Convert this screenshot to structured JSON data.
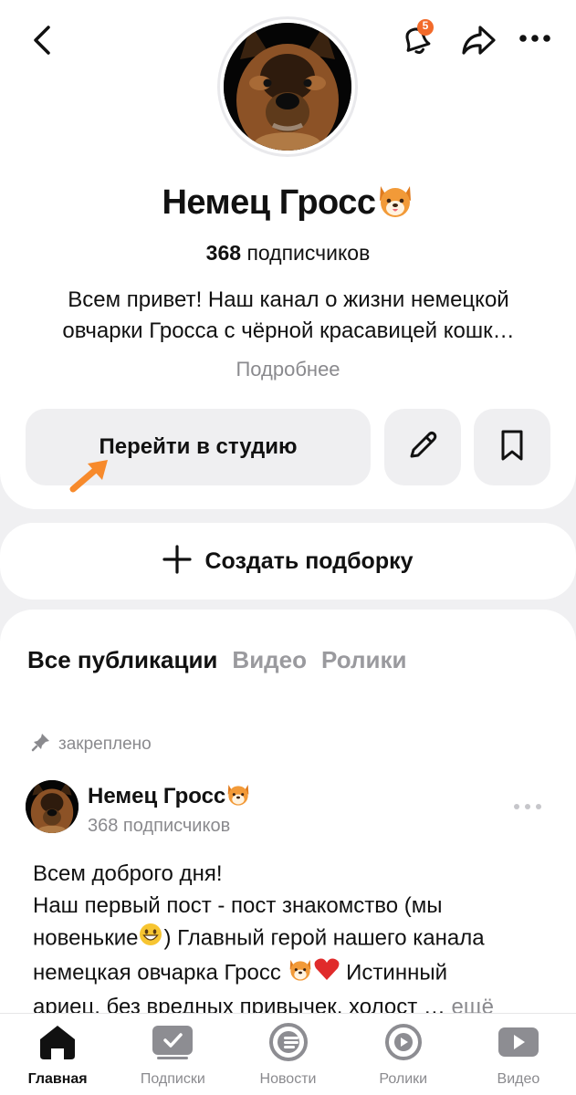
{
  "header": {
    "notifications_count": "5"
  },
  "profile": {
    "name": "Немец Гросс",
    "subscribers_count": "368",
    "subscribers_label": "подписчиков",
    "description_line1": "Всем привет! Наш канал о жизни немецкой",
    "description_line2": "овчарки Гросса с чёрной красавицей кошк…",
    "more_label": "Подробнее",
    "studio_button": "Перейти в студию"
  },
  "collection": {
    "create_label": "Создать подборку"
  },
  "feed": {
    "tabs": [
      "Все публикации",
      "Видео",
      "Ролики"
    ],
    "pinned_label": "закреплено",
    "post": {
      "author": "Немец Гросс",
      "subscribers": "368 подписчиков",
      "line1": "Всем доброго дня!",
      "line2": "Наш первый пост - пост знакомство (мы",
      "line3_a": "новенькие",
      "line3_b": ") Главный герой нашего канала",
      "line4_a": "немецкая овчарка Гросс ",
      "line4_b": " Истинный",
      "line5": "ариец, без вредных привычек, холост … ",
      "more": "ещё"
    }
  },
  "navbar": {
    "items": [
      "Главная",
      "Подписки",
      "Новости",
      "Ролики",
      "Видео"
    ]
  },
  "colors": {
    "accent_orange": "#f78a2c",
    "badge_orange": "#f26a2a",
    "muted_gray": "#8a8a8e"
  }
}
